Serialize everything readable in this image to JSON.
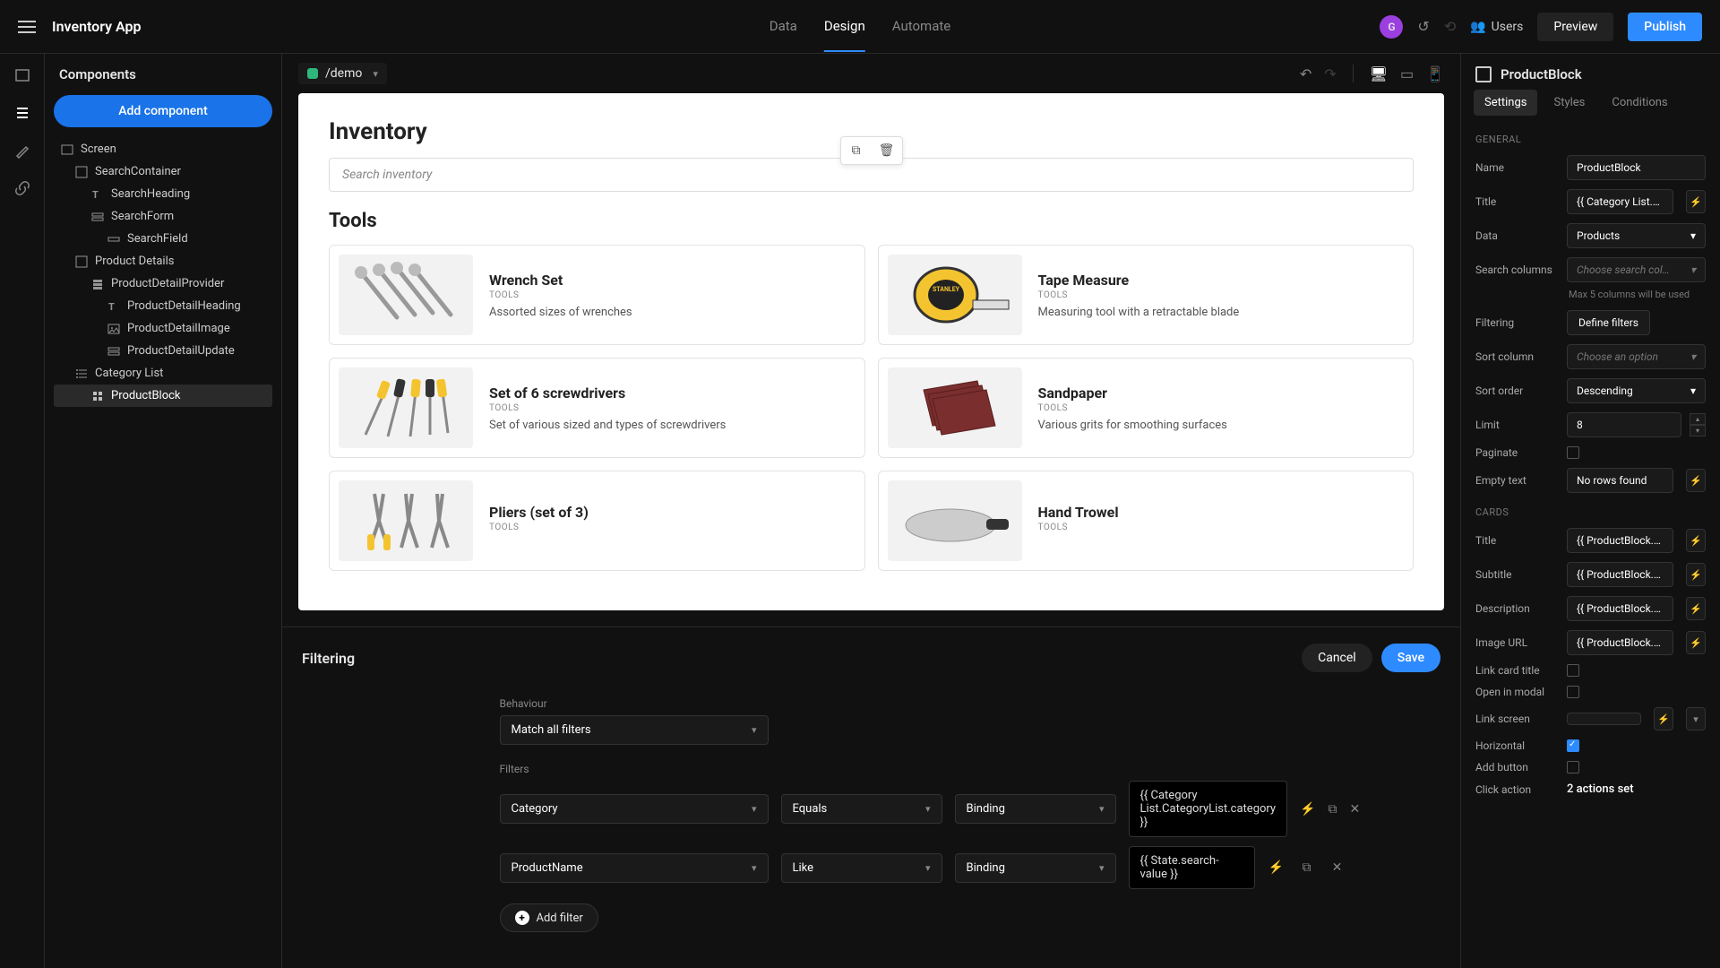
{
  "topbar": {
    "app_title": "Inventory App",
    "tabs": [
      "Data",
      "Design",
      "Automate"
    ],
    "active_tab": 1,
    "avatar_letter": "G",
    "users_label": "Users",
    "preview_label": "Preview",
    "publish_label": "Publish"
  },
  "route": {
    "path": "/demo"
  },
  "components_panel": {
    "title": "Components",
    "add_label": "Add component",
    "tree": [
      {
        "label": "Screen",
        "indent": 0,
        "icon": "screen"
      },
      {
        "label": "SearchContainer",
        "indent": 1,
        "icon": "container"
      },
      {
        "label": "SearchHeading",
        "indent": 2,
        "icon": "heading"
      },
      {
        "label": "SearchForm",
        "indent": 2,
        "icon": "form"
      },
      {
        "label": "SearchField",
        "indent": 3,
        "icon": "field"
      },
      {
        "label": "Product Details",
        "indent": 1,
        "icon": "container"
      },
      {
        "label": "ProductDetailProvider",
        "indent": 2,
        "icon": "provider"
      },
      {
        "label": "ProductDetailHeading",
        "indent": 3,
        "icon": "heading"
      },
      {
        "label": "ProductDetailImage",
        "indent": 3,
        "icon": "image"
      },
      {
        "label": "ProductDetailUpdate",
        "indent": 3,
        "icon": "form"
      },
      {
        "label": "Category List",
        "indent": 1,
        "icon": "list"
      },
      {
        "label": "ProductBlock",
        "indent": 2,
        "icon": "block",
        "selected": true
      }
    ]
  },
  "preview": {
    "heading": "Inventory",
    "search_placeholder": "Search inventory",
    "section": "Tools",
    "cards": [
      {
        "title": "Wrench Set",
        "cat": "TOOLS",
        "desc": "Assorted sizes of wrenches"
      },
      {
        "title": "Tape Measure",
        "cat": "TOOLS",
        "desc": "Measuring tool with a retractable blade"
      },
      {
        "title": "Set of 6 screwdrivers",
        "cat": "TOOLS",
        "desc": "Set of various sized and types of screwdrivers"
      },
      {
        "title": "Sandpaper",
        "cat": "TOOLS",
        "desc": "Various grits for smoothing surfaces"
      },
      {
        "title": "Pliers (set of 3)",
        "cat": "TOOLS",
        "desc": ""
      },
      {
        "title": "Hand Trowel",
        "cat": "TOOLS",
        "desc": ""
      }
    ]
  },
  "filtering": {
    "title": "Filtering",
    "cancel": "Cancel",
    "save": "Save",
    "behaviour_label": "Behaviour",
    "behaviour_value": "Match all filters",
    "filters_label": "Filters",
    "rows": [
      {
        "column": "Category",
        "operator": "Equals",
        "type": "Binding",
        "value": "{{ Category List.CategoryList.category }}"
      },
      {
        "column": "ProductName",
        "operator": "Like",
        "type": "Binding",
        "value": "{{ State.search-value }}"
      }
    ],
    "add_filter": "Add filter"
  },
  "settings": {
    "block_name": "ProductBlock",
    "tabs": [
      "Settings",
      "Styles",
      "Conditions"
    ],
    "active_tab": 0,
    "general_label": "GENERAL",
    "cards_label": "CARDS",
    "props": {
      "name_label": "Name",
      "name_value": "ProductBlock",
      "title_label": "Title",
      "title_value": "{{ Category List.C…",
      "data_label": "Data",
      "data_value": "Products",
      "search_cols_label": "Search columns",
      "search_cols_placeholder": "Choose search col…",
      "search_hint": "Max 5 columns will be used",
      "filtering_label": "Filtering",
      "filtering_value": "Define filters",
      "sort_col_label": "Sort column",
      "sort_col_placeholder": "Choose an option",
      "sort_order_label": "Sort order",
      "sort_order_value": "Descending",
      "limit_label": "Limit",
      "limit_value": "8",
      "paginate_label": "Paginate",
      "empty_label": "Empty text",
      "empty_value": "No rows found",
      "card_title_label": "Title",
      "card_title_value": "{{ ProductBlock.P…",
      "card_subtitle_label": "Subtitle",
      "card_subtitle_value": "{{ ProductBlock.P…",
      "card_desc_label": "Description",
      "card_desc_value": "{{ ProductBlock.P…",
      "card_img_label": "Image URL",
      "card_img_value": "{{ ProductBlock.P…",
      "link_title_label": "Link card title",
      "open_modal_label": "Open in modal",
      "link_screen_label": "Link screen",
      "horizontal_label": "Horizontal",
      "add_button_label": "Add button",
      "click_action_label": "Click action",
      "click_action_value": "2 actions set"
    }
  }
}
